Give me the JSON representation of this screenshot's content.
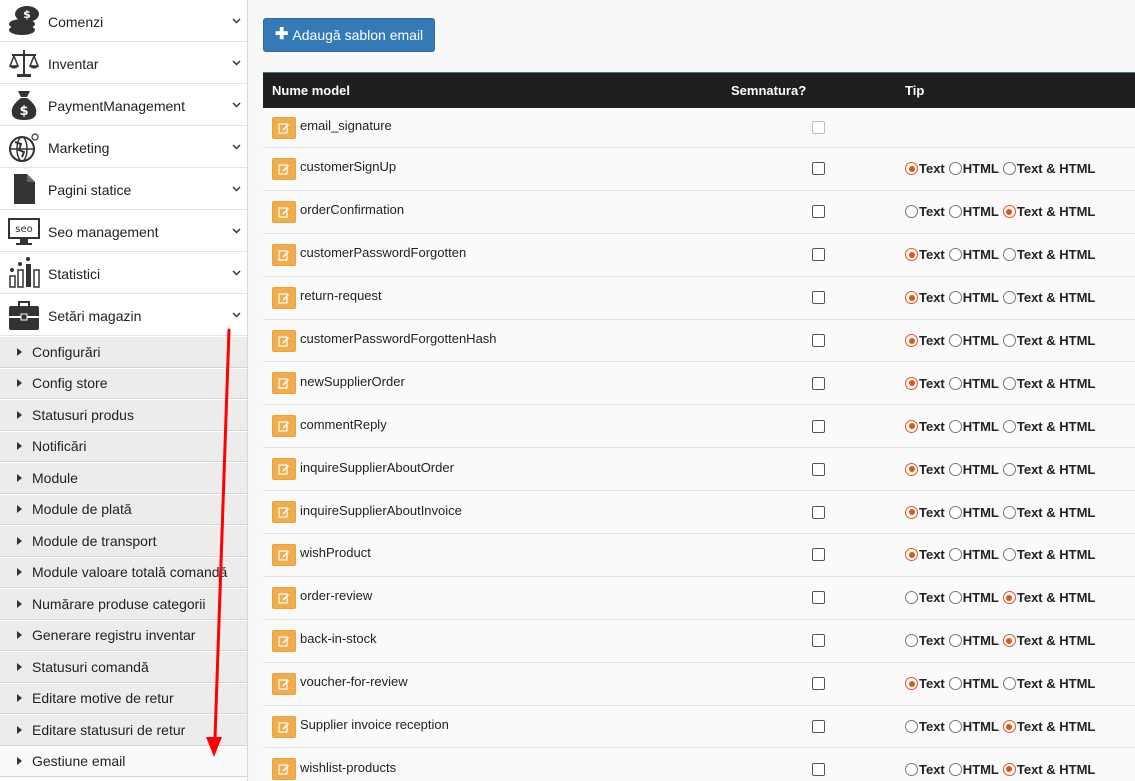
{
  "sidebar": {
    "items": [
      {
        "label": "Comenzi",
        "icon": "coins-icon"
      },
      {
        "label": "Inventar",
        "icon": "scale-icon"
      },
      {
        "label": "PaymentManagement",
        "icon": "money-bag-icon"
      },
      {
        "label": "Marketing",
        "icon": "globe-icon"
      },
      {
        "label": "Pagini statice",
        "icon": "document-icon"
      },
      {
        "label": "Seo management",
        "icon": "seo-monitor-icon"
      },
      {
        "label": "Statistici",
        "icon": "bar-chart-icon"
      },
      {
        "label": "Setări magazin",
        "icon": "briefcase-icon"
      }
    ],
    "sub_items": [
      "Configurări",
      "Config store",
      "Statusuri produs",
      "Notificări",
      "Module",
      "Module de plată",
      "Module de transport",
      "Module valoare totală comandă",
      "Numărare produse categorii",
      "Generare registru inventar",
      "Statusuri comandă",
      "Editare motive de retur",
      "Editare statusuri de retur",
      "Gestiune email"
    ],
    "active_sub_item": "Gestiune email"
  },
  "toolbar": {
    "add_button_label": "Adaugă sablon email"
  },
  "table": {
    "headers": {
      "name": "Nume model",
      "signature": "Semnatura?",
      "type": "Tip"
    },
    "type_options": [
      "Text",
      "HTML",
      "Text & HTML"
    ],
    "rows": [
      {
        "name": "email_signature",
        "signature_disabled": true,
        "type": null
      },
      {
        "name": "customerSignUp",
        "type": "Text"
      },
      {
        "name": "orderConfirmation",
        "type": "Text & HTML"
      },
      {
        "name": "customerPasswordForgotten",
        "type": "Text"
      },
      {
        "name": "return-request",
        "type": "Text"
      },
      {
        "name": "customerPasswordForgottenHash",
        "type": "Text"
      },
      {
        "name": "newSupplierOrder",
        "type": "Text"
      },
      {
        "name": "commentReply",
        "type": "Text"
      },
      {
        "name": "inquireSupplierAboutOrder",
        "type": "Text"
      },
      {
        "name": "inquireSupplierAboutInvoice",
        "type": "Text"
      },
      {
        "name": "wishProduct",
        "type": "Text"
      },
      {
        "name": "order-review",
        "type": "Text & HTML"
      },
      {
        "name": "back-in-stock",
        "type": "Text & HTML"
      },
      {
        "name": "voucher-for-review",
        "type": "Text"
      },
      {
        "name": "Supplier invoice reception",
        "type": "Text & HTML"
      },
      {
        "name": "wishlist-products",
        "type": "Text & HTML"
      }
    ]
  },
  "colors": {
    "primary": "#337ab7",
    "edit": "#f0ad4e",
    "radio_selected": "#e2531f",
    "header_bg": "#1f1f1f",
    "annotation_arrow": "#ff0000"
  }
}
